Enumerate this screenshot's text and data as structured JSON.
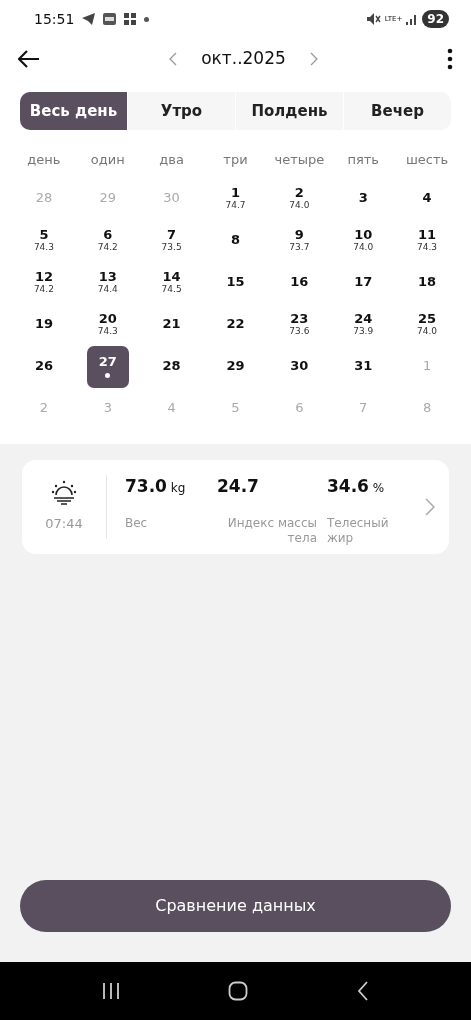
{
  "status_bar": {
    "time": "15:51",
    "network": "LTE+",
    "battery": "92"
  },
  "header": {
    "month": "окт..2025"
  },
  "tabs": [
    {
      "label": "Весь день",
      "selected": true
    },
    {
      "label": "Утро",
      "selected": false
    },
    {
      "label": "Полдень",
      "selected": false
    },
    {
      "label": "Вечер",
      "selected": false
    }
  ],
  "weekdays": [
    "день",
    "один",
    "два",
    "три",
    "четыре",
    "пять",
    "шесть"
  ],
  "days": [
    {
      "day": "28",
      "muted": true
    },
    {
      "day": "29",
      "muted": true
    },
    {
      "day": "30",
      "muted": true
    },
    {
      "day": "1",
      "value": "74.7"
    },
    {
      "day": "2",
      "value": "74.0"
    },
    {
      "day": "3"
    },
    {
      "day": "4"
    },
    {
      "day": "5",
      "value": "74.3"
    },
    {
      "day": "6",
      "value": "74.2"
    },
    {
      "day": "7",
      "value": "73.5"
    },
    {
      "day": "8"
    },
    {
      "day": "9",
      "value": "73.7"
    },
    {
      "day": "10",
      "value": "74.0"
    },
    {
      "day": "11",
      "value": "74.3"
    },
    {
      "day": "12",
      "value": "74.2"
    },
    {
      "day": "13",
      "value": "74.4"
    },
    {
      "day": "14",
      "value": "74.5"
    },
    {
      "day": "15"
    },
    {
      "day": "16"
    },
    {
      "day": "17"
    },
    {
      "day": "18"
    },
    {
      "day": "19"
    },
    {
      "day": "20",
      "value": "74.3"
    },
    {
      "day": "21"
    },
    {
      "day": "22"
    },
    {
      "day": "23",
      "value": "73.6"
    },
    {
      "day": "24",
      "value": "73.9"
    },
    {
      "day": "25",
      "value": "74.0"
    },
    {
      "day": "26"
    },
    {
      "day": "27",
      "selected": true,
      "dot": true
    },
    {
      "day": "28"
    },
    {
      "day": "29"
    },
    {
      "day": "30"
    },
    {
      "day": "31"
    },
    {
      "day": "1",
      "muted": true
    },
    {
      "day": "2",
      "muted": true
    },
    {
      "day": "3",
      "muted": true
    },
    {
      "day": "4",
      "muted": true
    },
    {
      "day": "5",
      "muted": true
    },
    {
      "day": "6",
      "muted": true
    },
    {
      "day": "7",
      "muted": true
    },
    {
      "day": "8",
      "muted": true
    }
  ],
  "record": {
    "time": "07:44",
    "metrics": [
      {
        "value": "73.0",
        "unit": "kg",
        "label": "Вес"
      },
      {
        "value": "24.7",
        "label": "Индекс массы тела"
      },
      {
        "value": "34.6",
        "unit": "%",
        "label": "Телесный жир"
      }
    ]
  },
  "compare_button": "Сравнение данных"
}
